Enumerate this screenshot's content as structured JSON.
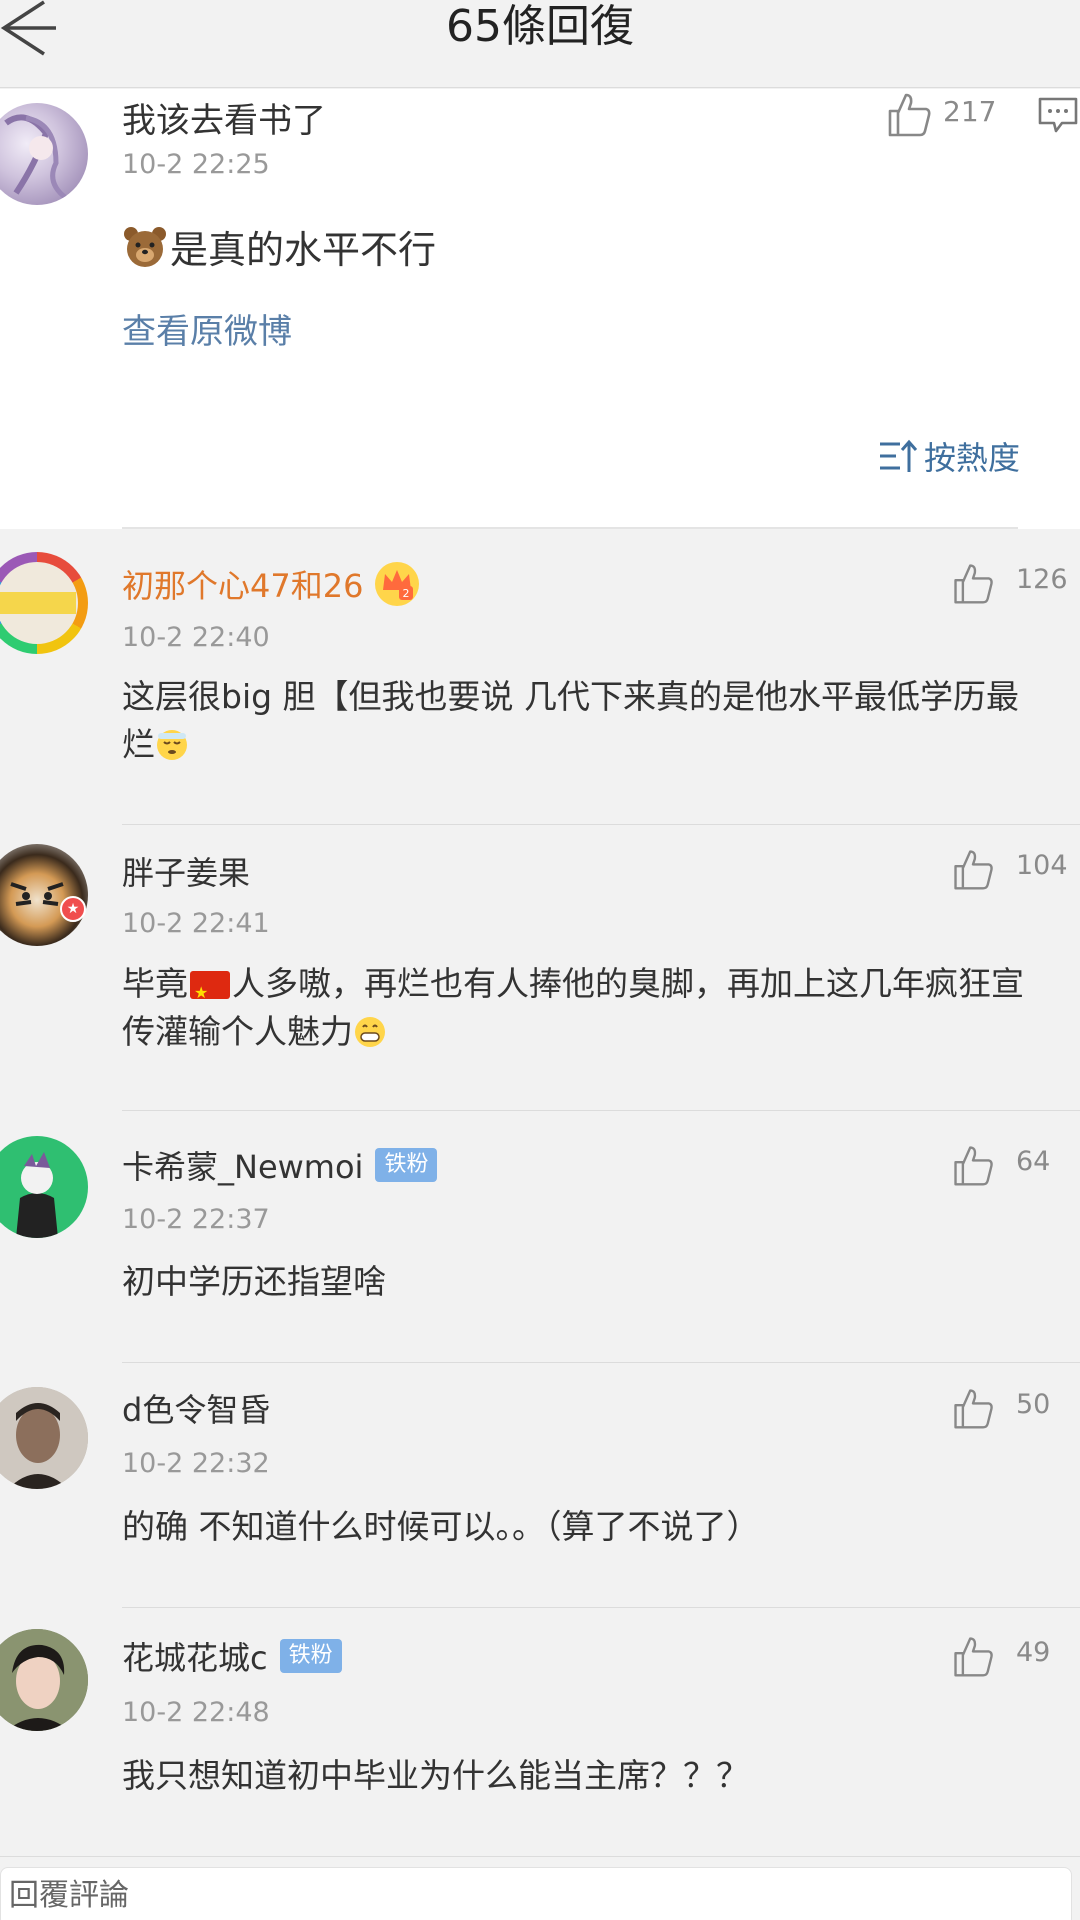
{
  "header": {
    "title": "65條回復",
    "back_icon": "arrow-left-icon"
  },
  "original_post": {
    "author": "我该去看书了",
    "time": "10-2 22:25",
    "like_count": "217",
    "text": "是真的水平不行",
    "text_emoji": "bear-face",
    "view_original": "查看原微博",
    "sort_label": "按熱度"
  },
  "comments": [
    {
      "author": "初那个心47和26",
      "author_color": "#e0782b",
      "badge": "crown",
      "time": "10-2 22:40",
      "like_count": "126",
      "text": "这层很big 胆【但我也要说  几代下来真的是他水平最低学历最烂"
    },
    {
      "author": "胖子姜果",
      "time": "10-2 22:41",
      "like_count": "104",
      "text_before_flag": "毕竟",
      "text_after_flag": "人多嗷，再烂也有人捧他的臭脚，再加上这几年疯狂宣传灌输个人魅力"
    },
    {
      "author": "卡希蒙_Newmoi",
      "badge": "铁粉",
      "time": "10-2 22:37",
      "like_count": "64",
      "text": "初中学历还指望啥"
    },
    {
      "author": "d色令智昏",
      "time": "10-2 22:32",
      "like_count": "50",
      "text": "的确 不知道什么时候可以。。（算了不说了）"
    },
    {
      "author": "花城花城c",
      "badge": "铁粉",
      "time": "10-2 22:48",
      "like_count": "49",
      "text": "我只想知道初中毕业为什么能当主席？？？"
    }
  ],
  "reply_bar": {
    "placeholder": "回覆評論"
  },
  "colors": {
    "link": "#5a7fa8",
    "background": "#f2f2f2",
    "fan_badge": "#7fb1e8"
  }
}
